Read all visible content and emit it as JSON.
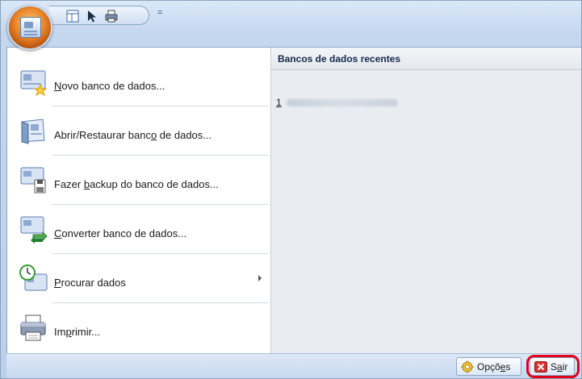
{
  "quick_access": {
    "buttons": [
      "layout-icon",
      "pointer-icon",
      "printer-icon"
    ],
    "more_glyph": "="
  },
  "menu": {
    "items": [
      {
        "label_pre": "",
        "hotkey": "N",
        "label_post": "ovo banco de dados...",
        "icon": "new-database-icon"
      },
      {
        "label_pre": "Abrir/Restaurar banc",
        "hotkey": "o",
        "label_post": " de dados...",
        "icon": "open-database-icon"
      },
      {
        "label_pre": "Fazer ",
        "hotkey": "b",
        "label_post": "ackup do banco de dados...",
        "icon": "backup-database-icon"
      },
      {
        "label_pre": "",
        "hotkey": "C",
        "label_post": "onverter banco de dados...",
        "icon": "convert-database-icon"
      },
      {
        "label_pre": "",
        "hotkey": "P",
        "label_post": "rocurar dados",
        "icon": "search-data-icon",
        "has_submenu": true
      },
      {
        "label_pre": "Im",
        "hotkey": "p",
        "label_post": "rimir...",
        "icon": "printer-icon"
      }
    ]
  },
  "recent": {
    "header": "Bancos de dados recentes",
    "items": [
      {
        "number": "1"
      }
    ]
  },
  "bottom": {
    "options_pre": "Opçõ",
    "options_hotkey": "e",
    "options_post": "s",
    "exit_pre": "S",
    "exit_hotkey": "a",
    "exit_post": "ir"
  },
  "colors": {
    "highlight": "#e0001b",
    "orb": "#e9862a",
    "ribbon": "#c4d7ef"
  }
}
